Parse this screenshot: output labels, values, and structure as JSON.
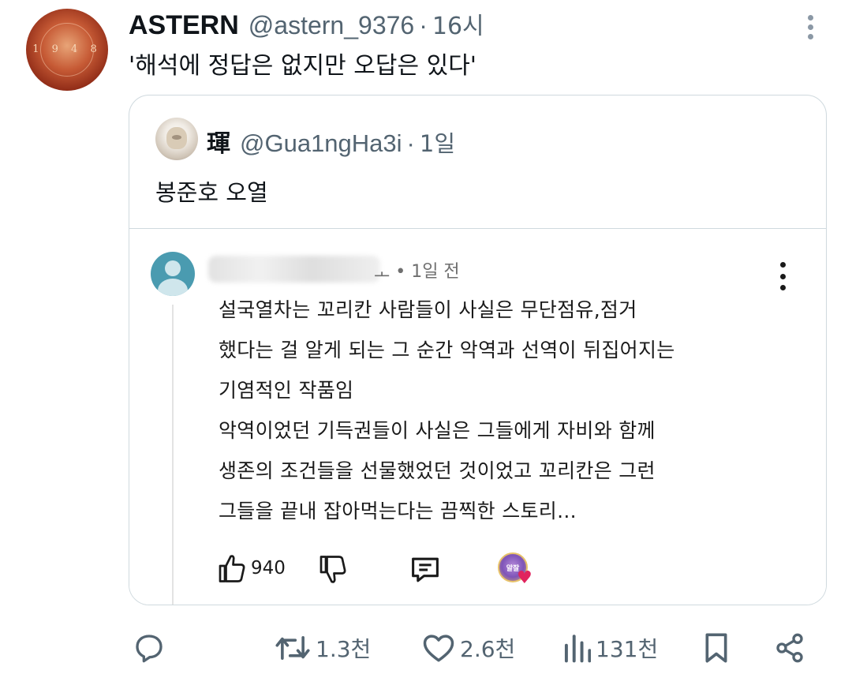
{
  "tweet": {
    "display_name": "ASTERN",
    "handle": "@astern_9376",
    "separator": "·",
    "time": "16시",
    "text": "'해석에 정답은 없지만 오답은 있다'",
    "avatar_logo": "1 9 4 8",
    "avatar_icon": "circular-logo-avatar",
    "more_icon": "vertical-ellipsis-icon"
  },
  "quote": {
    "display_name": "琿",
    "handle": "@Gua1ngHa3i",
    "separator": "·",
    "time": "1일",
    "text": "봉준호 오열",
    "avatar_icon": "dog-photo-avatar",
    "image": {
      "comment_meta": "ᅟᅩ • 1일 전",
      "lines": [
        "설국열차는 꼬리칸 사람들이 사실은 무단점유,점거",
        "했다는 걸 알게 되는 그 순간 악역과 선역이 뒤집어지는",
        "기염적인 작품임",
        "악역이었던 기득권들이 사실은 그들에게 자비와 함께",
        "생존의 조건들을 선물했었던 것이었고 꼬리칸은 그런",
        "그들을 끝내 잡아먹는다는 끔찍한 스토리..."
      ],
      "like_count": "940",
      "badge_text": "알잘",
      "icons": [
        "thumbs-up-icon",
        "thumbs-down-icon",
        "reply-icon",
        "creator-heart-icon"
      ]
    }
  },
  "actions": {
    "reply_count": "",
    "retweet_count": "1.3천",
    "like_count": "2.6천",
    "views_count": "131천",
    "icons": [
      "reply-icon",
      "retweet-icon",
      "heart-icon",
      "views-icon",
      "bookmark-icon",
      "share-icon"
    ]
  },
  "colors": {
    "text_primary": "#0f1419",
    "text_secondary": "#536471",
    "border": "#cfd9de",
    "heart_red": "#e0245e"
  }
}
